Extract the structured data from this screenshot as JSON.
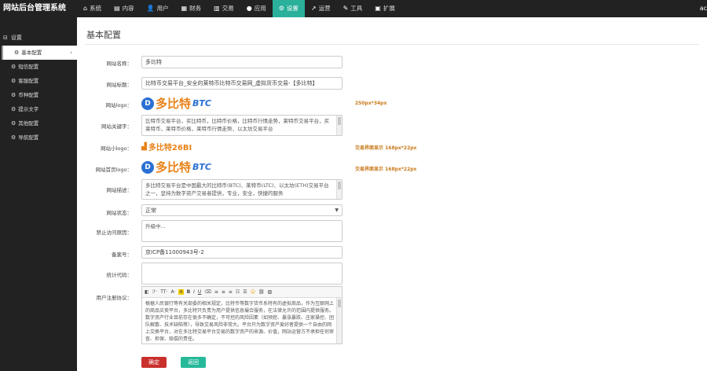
{
  "brand": "网站后台管理系统",
  "user_short": "ac",
  "topnav": [
    {
      "icon": "home-icon",
      "glyph": "⌂",
      "label": "系统"
    },
    {
      "icon": "content-icon",
      "glyph": "▤",
      "label": "内容"
    },
    {
      "icon": "user-icon",
      "glyph": "👤",
      "label": "用户"
    },
    {
      "icon": "finance-icon",
      "glyph": "▦",
      "label": "财务"
    },
    {
      "icon": "trade-icon",
      "glyph": "▥",
      "label": "交易"
    },
    {
      "icon": "apps-icon",
      "glyph": "●",
      "label": "应用"
    },
    {
      "icon": "settings-icon",
      "glyph": "⚙",
      "label": "设置"
    },
    {
      "icon": "operate-icon",
      "glyph": "↗",
      "label": "运营"
    },
    {
      "icon": "tools-icon",
      "glyph": "✎",
      "label": "工具"
    },
    {
      "icon": "extend-icon",
      "glyph": "▣",
      "label": "扩展"
    }
  ],
  "sidebar": {
    "heading": "设置",
    "items": [
      "基本配置",
      "短信配置",
      "客服配置",
      "币种配置",
      "提示文字",
      "其他配置",
      "导航配置"
    ]
  },
  "page_title": "基本配置",
  "form": {
    "site_name_label": "网站名称：",
    "site_name_value": "多比特",
    "site_title_label": "网站标题：",
    "site_title_value": "比特币交易平台_安全的莱特币比特币交易网_虚拟货币交易-【多比特】",
    "site_logo_label": "网站logo：",
    "site_logo_hint": "250px*34px",
    "keywords_label": "网站关键字：",
    "keywords_value": "比特币交易平台，买比特币，比特币价格，比特币行情走势，莱特币交易平台，买莱特币，莱特币价格，莱特币行情走势，以太坊交易平台",
    "small_logo_label": "网站小logo：",
    "small_logo_hint": "交易界面显示 168px*22px",
    "home_logo_label": "网站首页logo：",
    "home_logo_hint": "交易界面显示 168px*22px",
    "desc_label": "网站描述：",
    "desc_value": "多比特交易平台是中国最大的比特币(BTC)、莱特币(LTC)、以太坊(ETH)交易平台之一，坚持为数字资产交易者提供，专业，安全，快捷的服务",
    "status_label": "网站状态：",
    "status_value": "正常",
    "closed_msg_label": "禁止访问原因：",
    "closed_msg_value": "升级中...",
    "icp_label": "备案号：",
    "icp_value": "京ICP备11000943号-2",
    "stats_label": "统计代码：",
    "stats_value": "",
    "agreement_label": "用户注册协议：",
    "agreement_text": "根据人民银行等有关部委的相关规定，比特币等数字货币系特有的虚拟商品，作为互联网上的商品买卖平台，多比特只负责为用户提供信息撮合服务，在法律允许的范围内提供服务。数字资产行业目前存在很多不确定，不可控的风险因素（如预挖、暴涨暴跌、庄家操控、团队解散、技术缺陷等），导致交易风险非常大。平台只为数字资产爱好者提供一个自由的网上交换平台，对在多比特交易平台交易的数字资产的来源、价值，网站运营方不承担任何审查、担保、赔偿的责任。",
    "logo_text": "多比特",
    "logo_text_small": "多比特26BI",
    "logo_btc": "BTC",
    "btn_ok": "确定",
    "btn_back": "返回"
  }
}
